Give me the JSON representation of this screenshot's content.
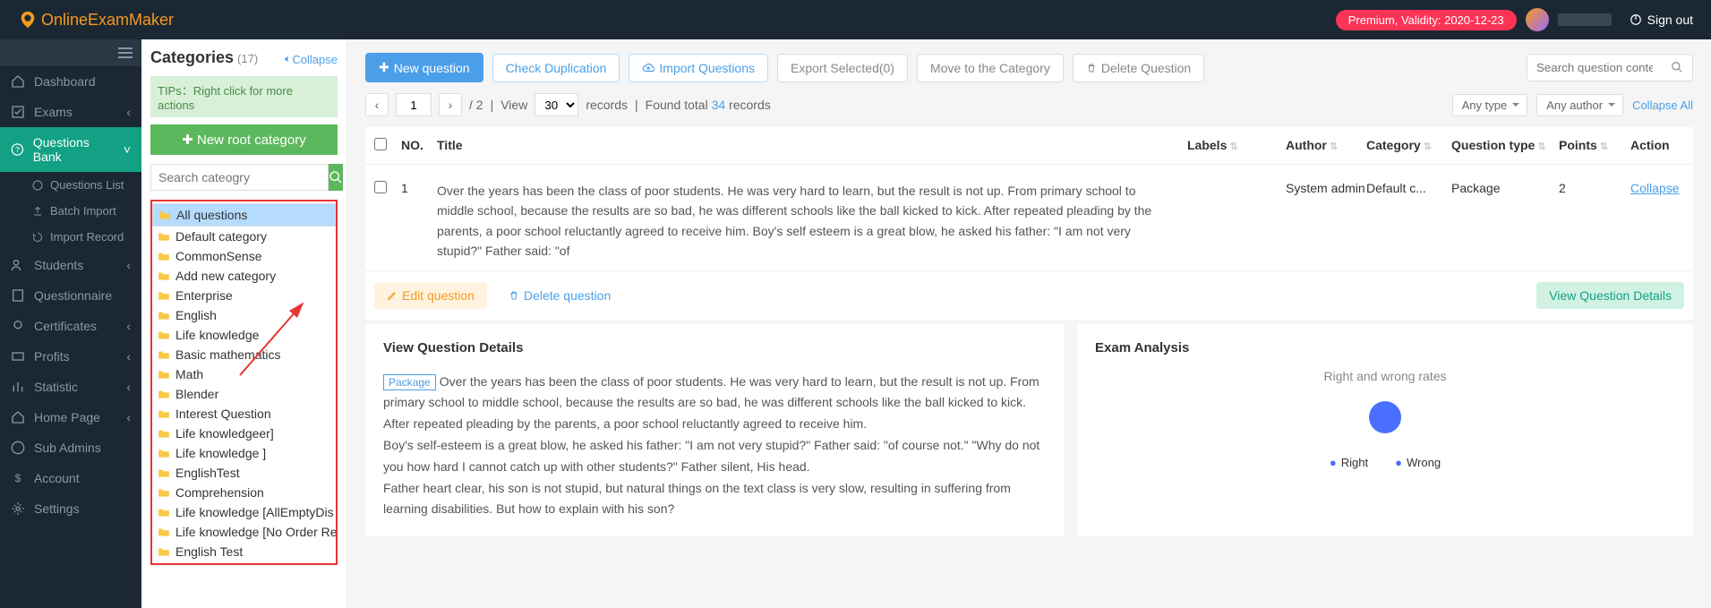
{
  "header": {
    "brand": "OnlineExamMaker",
    "premium": "Premium, Validity: 2020-12-23",
    "signout": "Sign out"
  },
  "nav": {
    "dashboard": "Dashboard",
    "exams": "Exams",
    "qbank": "Questions Bank",
    "qlist": "Questions List",
    "batch": "Batch Import",
    "import_rec": "Import Record",
    "students": "Students",
    "questionnaire": "Questionnaire",
    "certificates": "Certificates",
    "profits": "Profits",
    "statistic": "Statistic",
    "homepage": "Home Page",
    "subadmins": "Sub Admins",
    "account": "Account",
    "settings": "Settings"
  },
  "cat": {
    "title": "Categories",
    "count": "(17)",
    "collapse": "Collapse",
    "tips": "TIPs：Right click for more actions",
    "new_root": "New root category",
    "search_ph": "Search cateogry",
    "items": [
      "All questions",
      "Default category",
      "CommonSense",
      "Add new category",
      "Enterprise",
      "English",
      "Life knowledge",
      "Basic mathematics",
      "Math",
      "Blender",
      "Interest Question",
      "Life knowledgeer]",
      "Life knowledge ]",
      "EnglishTest",
      "Comprehension",
      "Life knowledge [AllEmptyDis",
      "Life knowledge [No Order Re",
      "English Test"
    ]
  },
  "toolbar": {
    "new_q": "New question",
    "check_dup": "Check Duplication",
    "import_q": "Import Questions",
    "export_sel": "Export Selected(0)",
    "move_cat": "Move to the Category",
    "del_q": "Delete Question",
    "search_ph": "Search question content"
  },
  "pager": {
    "page": "1",
    "total_pages": "/ 2",
    "sep": "|",
    "view": "View",
    "per": "30",
    "records": "records",
    "sep2": "|",
    "found_pre": "Found total ",
    "found_n": "34",
    "found_post": " records",
    "any_type": "Any type",
    "any_author": "Any author",
    "collapse_all": "Collapse All"
  },
  "thead": {
    "no": "NO.",
    "title": "Title",
    "labels": "Labels",
    "author": "Author",
    "category": "Category",
    "qtype": "Question type",
    "points": "Points",
    "action": "Action"
  },
  "row": {
    "no": "1",
    "title": "Over the years has been the class of poor students. He was very hard to learn, but the result is not up. From primary school to middle school, because the results are so bad, he was different schools like the ball kicked to kick. After repeated pleading by the parents, a poor school reluctantly agreed to receive him.\nBoy's self esteem is a great blow, he asked his father: \"I am not very stupid?\" Father said: \"of",
    "author": "System admin",
    "category": "Default c...",
    "qtype": "Package",
    "points": "2",
    "action": "Collapse"
  },
  "editbar": {
    "edit": "Edit question",
    "delete": "Delete question",
    "view": "View Question Details"
  },
  "details": {
    "heading": "View Question Details",
    "badge": "Package",
    "p1": "Over the years has been the class of poor students. He was very hard to learn, but the result is not up. From primary school to middle school, because the results are so bad, he was different schools like the ball kicked to kick. After repeated pleading by the parents, a poor school reluctantly agreed to receive him.",
    "p2": "Boy's self-esteem is a great blow, he asked his father: \"I am not very stupid?\" Father said: \"of course not.\" \"Why do not you how hard I cannot catch up with other students?\" Father silent, His head.",
    "p3": "Father heart clear, his son is not stupid, but natural things on the text class is very slow, resulting in suffering from learning disabilities. But how to explain with his son?"
  },
  "analysis": {
    "heading": "Exam Analysis",
    "rates": "Right and wrong rates",
    "right": "Right",
    "wrong": "Wrong"
  },
  "chart_data": {
    "type": "pie",
    "title": "Right and wrong rates",
    "series": [
      {
        "name": "Right",
        "value": 100,
        "color": "#4a6fff"
      },
      {
        "name": "Wrong",
        "value": 0,
        "color": "#4a6fff"
      }
    ]
  }
}
